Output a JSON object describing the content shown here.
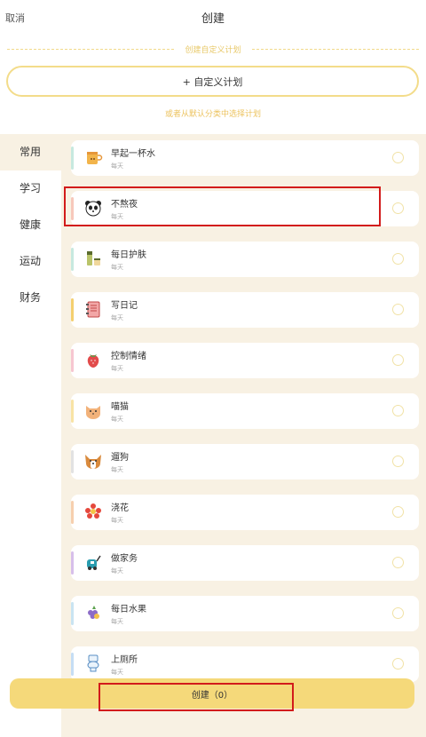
{
  "header": {
    "cancel": "取消",
    "title": "创建"
  },
  "custom": {
    "divider_label": "创建自定义计划",
    "button_label": "+ 自定义计划",
    "hint": "或者从默认分类中选择计划"
  },
  "sidebar": {
    "items": [
      {
        "label": "常用",
        "active": true
      },
      {
        "label": "学习",
        "active": false
      },
      {
        "label": "健康",
        "active": false
      },
      {
        "label": "运动",
        "active": false
      },
      {
        "label": "财务",
        "active": false
      }
    ]
  },
  "plans": [
    {
      "name": "早起一杯水",
      "freq": "每天",
      "icon": "cup-icon",
      "color": "#c7e9df"
    },
    {
      "name": "不熬夜",
      "freq": "每天",
      "icon": "panda-icon",
      "color": "#f7c8bb"
    },
    {
      "name": "每日护肤",
      "freq": "每天",
      "icon": "skincare-icon",
      "color": "#c7e9df"
    },
    {
      "name": "写日记",
      "freq": "每天",
      "icon": "diary-icon",
      "color": "#f4cf6f"
    },
    {
      "name": "控制情绪",
      "freq": "每天",
      "icon": "strawberry-icon",
      "color": "#f6c6d1"
    },
    {
      "name": "喵猫",
      "freq": "每天",
      "icon": "cat-icon",
      "color": "#f8e3a5"
    },
    {
      "name": "遛狗",
      "freq": "每天",
      "icon": "dog-icon",
      "color": "#e2e2e2"
    },
    {
      "name": "浇花",
      "freq": "每天",
      "icon": "flower-icon",
      "color": "#f6cfae"
    },
    {
      "name": "做家务",
      "freq": "每天",
      "icon": "vacuum-icon",
      "color": "#d7bfea"
    },
    {
      "name": "每日水果",
      "freq": "每天",
      "icon": "fruit-icon",
      "color": "#c9e4f2"
    },
    {
      "name": "上厕所",
      "freq": "每天",
      "icon": "toilet-icon",
      "color": "#c5ddf4"
    }
  ],
  "footer": {
    "create_label": "创建（0）"
  }
}
